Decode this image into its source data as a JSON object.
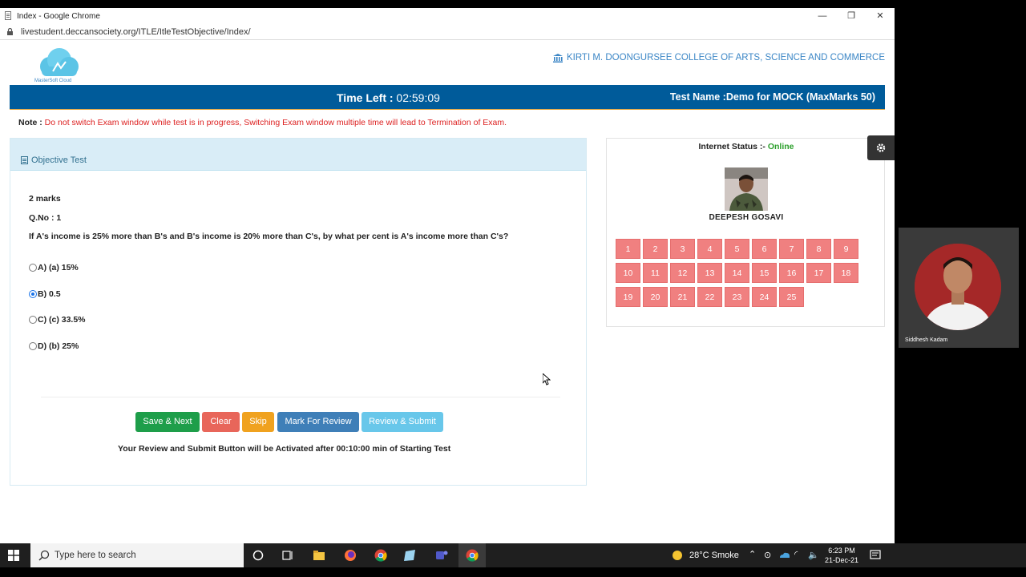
{
  "window": {
    "title": "Index - Google Chrome",
    "url": "livestudent.deccansociety.org/ITLE/ItleTestObjective/Index/",
    "minimize": "—",
    "restore": "❐",
    "close": "✕"
  },
  "header": {
    "logo_text": "MasterSoft Cloud",
    "college": "KIRTI M. DOONGURSEE COLLEGE OF ARTS, SCIENCE AND COMMERCE",
    "time_left_label": "Time Left :",
    "time_left_value": "02:59:09",
    "test_name": "Test Name :Demo for MOCK (MaxMarks 50)"
  },
  "note": {
    "label": "Note :",
    "text": "Do not switch Exam window while test is in progress, Switching Exam window multiple time will lead to Termination of Exam."
  },
  "question_panel": {
    "heading": "Objective Test",
    "marks": "2 marks",
    "qno": "Q.No : 1",
    "question": "If A's income is 25% more than B's and B's income is 20% more than C's, by what per cent is A's income more than C's?",
    "options": [
      {
        "label": "A) (a) 15%",
        "selected": false
      },
      {
        "label": "B) 0.5",
        "selected": true
      },
      {
        "label": "C) (c) 33.5%",
        "selected": false
      },
      {
        "label": "D) (b) 25%",
        "selected": false
      }
    ],
    "buttons": {
      "save_next": "Save & Next",
      "clear": "Clear",
      "skip": "Skip",
      "mark_review": "Mark For Review",
      "review_submit": "Review & Submit"
    },
    "activation_note": "Your Review and Submit Button will be Activated after 00:10:00 min of Starting Test"
  },
  "student_panel": {
    "internet_label": "Internet Status :-",
    "internet_value": "Online",
    "student_name": "DEEPESH GOSAVI",
    "questions": [
      "1",
      "2",
      "3",
      "4",
      "5",
      "6",
      "7",
      "8",
      "9",
      "10",
      "11",
      "12",
      "13",
      "14",
      "15",
      "16",
      "17",
      "18",
      "19",
      "20",
      "21",
      "22",
      "23",
      "24",
      "25"
    ]
  },
  "video": {
    "participant": "Siddhesh Kadam"
  },
  "taskbar": {
    "search_placeholder": "Type here to search",
    "weather": "28°C  Smoke",
    "time": "6:23 PM",
    "date": "21-Dec-21"
  },
  "colors": {
    "header_blue": "#005b9a",
    "question_button": "#f08080",
    "save_next": "#1e9e4a",
    "clear": "#e8665a",
    "skip": "#f0a21f",
    "mark_review": "#3f7fb8",
    "review_submit": "#68c7ea",
    "online": "#2ca02c",
    "note_red": "#d22222"
  }
}
